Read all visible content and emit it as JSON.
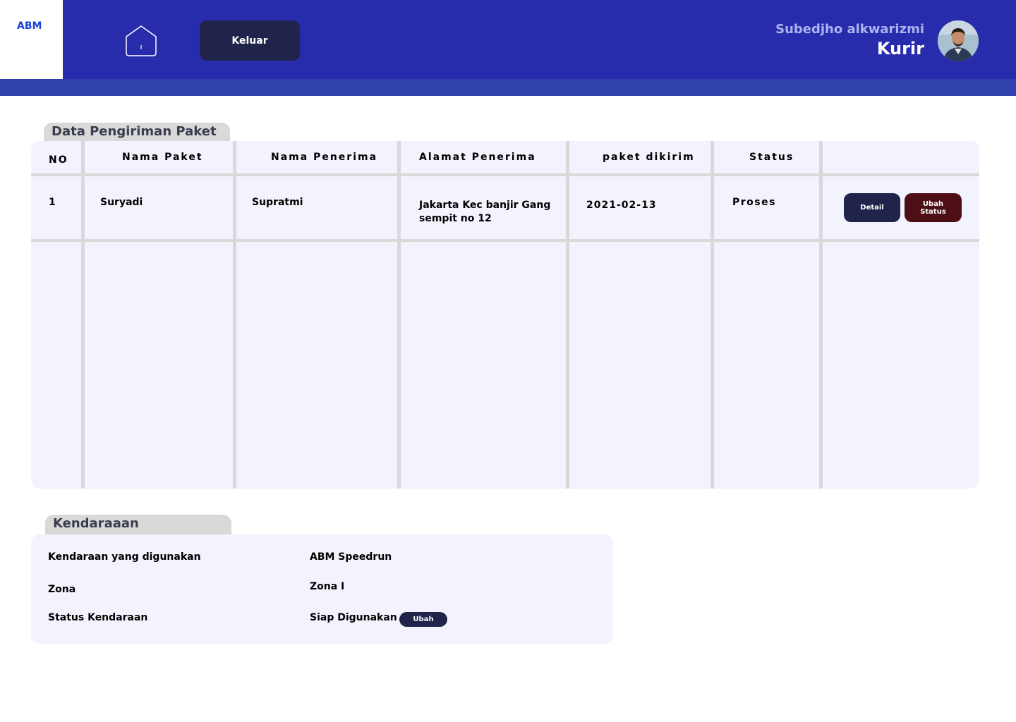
{
  "brand": {
    "logo": "ABM"
  },
  "header": {
    "home_icon": "home-icon",
    "logout_label": "Keluar",
    "user_name": "Subedjho alkwarizmi",
    "user_role": "Kurir"
  },
  "shipments": {
    "title": "Data Pengiriman Paket",
    "columns": [
      "NO",
      "Nama Paket",
      "Nama Penerima",
      "Alamat Penerima",
      "paket dikirim",
      "Status"
    ],
    "rows": [
      {
        "no": "1",
        "nama_paket": "Suryadi",
        "nama_penerima": "Supratmi",
        "alamat": "Jakarta Kec banjir Gang sempit no 12",
        "dikirim": "2021-02-13",
        "status": "Proses",
        "detail_label": "Detail",
        "ubah_status_label": "Ubah Status"
      }
    ]
  },
  "vehicle": {
    "title": "Kendaraaan",
    "fields": [
      {
        "label": "Kendaraan yang digunakan",
        "value": "ABM Speedrun"
      },
      {
        "label": "Zona",
        "value": "Zona I"
      },
      {
        "label": "Status Kendaraan",
        "value": "Siap Digunakan"
      }
    ],
    "ubah_label": "Ubah"
  },
  "colors": {
    "header": "#272cad",
    "header_band": "#3040ac",
    "panel": "#f3f3fd",
    "grid": "#d9d9d9",
    "dark_button": "#20244a",
    "danger_button": "#4d0f15",
    "brand_text": "#1d3fdc"
  }
}
